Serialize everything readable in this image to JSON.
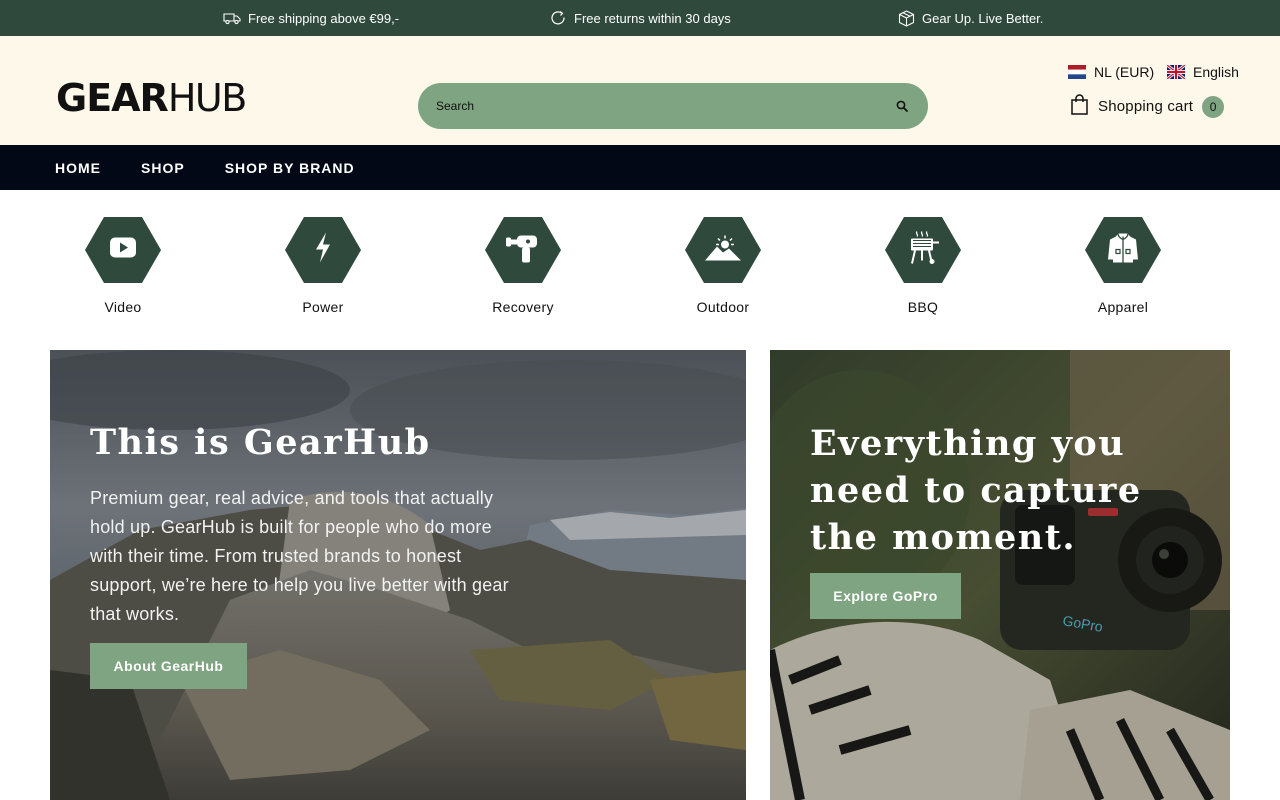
{
  "announcement": {
    "shipping": "Free shipping above €99,-",
    "returns": "Free returns within 30 days",
    "tagline": "Gear Up. Live Better.",
    "icons": [
      "truck-icon",
      "refresh-icon",
      "box-icon"
    ]
  },
  "header": {
    "logo_part1": "GEAR",
    "logo_part2": "HUB",
    "search_placeholder": "Search",
    "country": "NL (EUR)",
    "language": "English",
    "cart_label": "Shopping cart",
    "cart_count": "0"
  },
  "nav": {
    "items": [
      {
        "label": "HOME"
      },
      {
        "label": "SHOP"
      },
      {
        "label": "SHOP BY BRAND"
      }
    ]
  },
  "categories": [
    {
      "label": "Video",
      "icon": "play-icon"
    },
    {
      "label": "Power",
      "icon": "lightning-icon"
    },
    {
      "label": "Recovery",
      "icon": "massage-gun-icon"
    },
    {
      "label": "Outdoor",
      "icon": "mountain-sun-icon"
    },
    {
      "label": "BBQ",
      "icon": "grill-icon"
    },
    {
      "label": "Apparel",
      "icon": "jacket-icon"
    }
  ],
  "hero_left": {
    "title": "This is GearHub",
    "text": "Premium gear, real advice, and tools that actually hold up. GearHub is built for people who do more with their time. From trusted brands to honest support, we’re here to help you live better with gear that works.",
    "button": "About GearHub"
  },
  "hero_right": {
    "title": "Everything you need to capture the moment.",
    "button": "Explore GoPro",
    "camera_brand": "GoPro"
  },
  "colors": {
    "announcement_bg": "#2f4a3c",
    "header_bg": "#fdf8ea",
    "accent_green": "#7fa481",
    "nav_bg": "#020816",
    "hex_icon_bg": "#2f4a3c"
  }
}
